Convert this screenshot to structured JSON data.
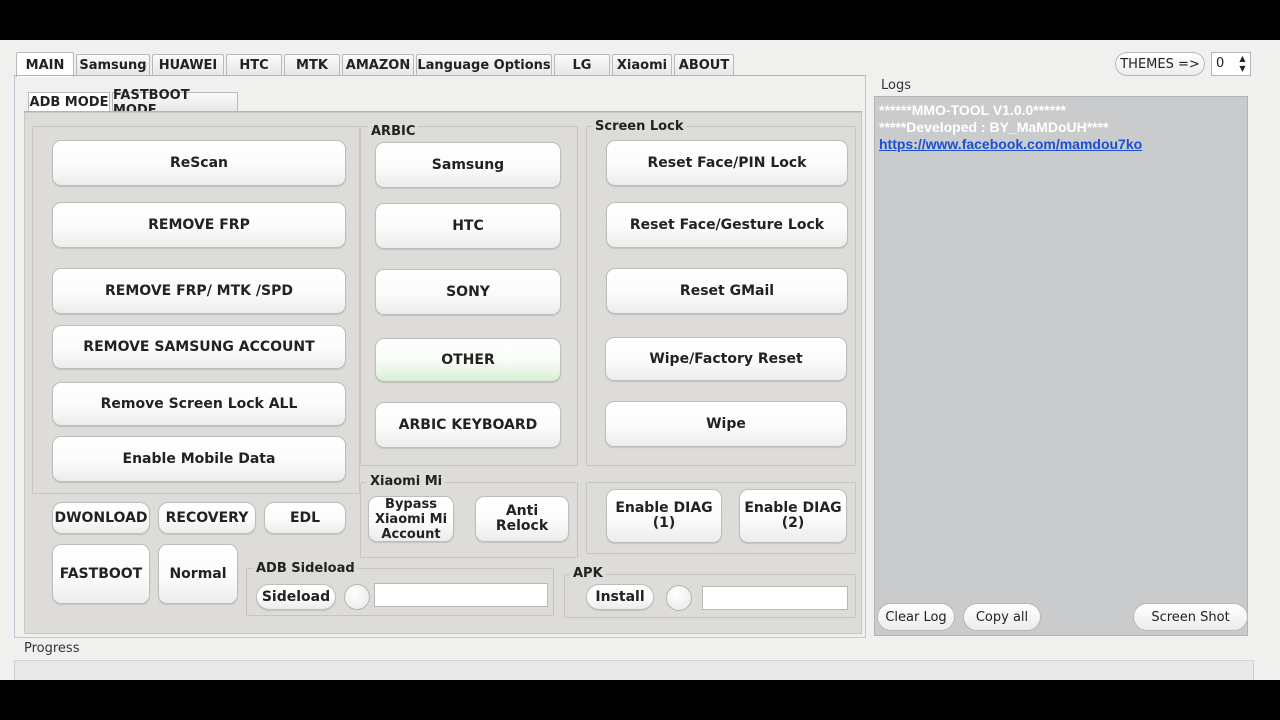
{
  "tabs": [
    "MAIN",
    "Samsung",
    "HUAWEI",
    "HTC",
    "MTK",
    "AMAZON",
    "Language Options",
    "LG",
    "Xiaomi",
    "ABOUT"
  ],
  "subtabs": [
    "ADB MODE",
    "FASTBOOT MODE"
  ],
  "left_buttons": {
    "rescan": "ReScan",
    "remove_frp": "REMOVE FRP",
    "remove_frp_mtk": "REMOVE FRP/ MTK /SPD",
    "remove_samsung": "REMOVE SAMSUNG ACCOUNT",
    "remove_screen_lock": "Remove Screen Lock ALL",
    "enable_mobile_data": "Enable Mobile Data"
  },
  "arbic": {
    "title": "ARBIC",
    "samsung": "Samsung",
    "htc": "HTC",
    "sony": "SONY",
    "other": "OTHER",
    "keyboard": "ARBIC KEYBOARD"
  },
  "screen_lock": {
    "title": "Screen Lock",
    "reset_face_pin": "Reset Face/PIN Lock",
    "reset_face_gesture": "Reset Face/Gesture Lock",
    "reset_gmail": "Reset GMail",
    "wipe_factory": "Wipe/Factory Reset",
    "wipe": "Wipe"
  },
  "boot": {
    "download": "DWONLOAD",
    "recovery": "RECOVERY",
    "edl": "EDL",
    "fastboot": "FASTBOOT",
    "normal": "Normal"
  },
  "xiaomi": {
    "title": "Xiaomi Mi",
    "bypass": "Bypass Xiaomi Mi Account",
    "anti_relock": "Anti Relock"
  },
  "diag": {
    "enable1": "Enable DIAG (1)",
    "enable2": "Enable DIAG (2)"
  },
  "sideload": {
    "title": "ADB Sideload",
    "button": "Sideload"
  },
  "apk": {
    "title": "APK",
    "button": "Install"
  },
  "themes": {
    "label": "THEMES =>",
    "value": "0"
  },
  "logs": {
    "label": "Logs",
    "line1": "******MMO-TOOL V1.0.0******",
    "line2": "*****Developed : BY_MaMDoUH****",
    "link": "https://www.facebook.com/mamdou7ko"
  },
  "log_buttons": {
    "clear": "Clear Log",
    "copy": "Copy all",
    "screenshot": "Screen Shot"
  },
  "progress": {
    "label": "Progress"
  }
}
